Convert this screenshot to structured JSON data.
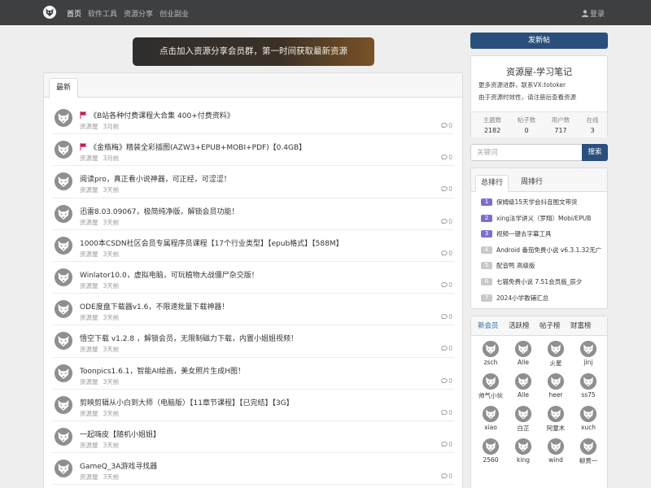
{
  "nav": {
    "logo_icon": "fox-logo-icon",
    "links": [
      "首页",
      "软件工具",
      "资源分享",
      "创业副业"
    ],
    "active_index": 0,
    "login_label": "登录",
    "login_icon": "user-icon"
  },
  "banner": {
    "text": "点击加入资源分享会员群，第一时间获取最新资源"
  },
  "main": {
    "tab_label": "最新",
    "threads": [
      {
        "pinned": true,
        "title": "《B站各种付费课程大合集 400+付费资料》",
        "author": "资源屋",
        "time": "3月前",
        "replies": "0"
      },
      {
        "pinned": true,
        "title": "《金瓶梅》精装全彩插图(AZW3+EPUB+MOBI+PDF)【0.4GB】",
        "author": "资源屋",
        "time": "3月前",
        "replies": "0"
      },
      {
        "pinned": false,
        "title": "阅读pro，真正看小说神器，可正经，可涩涩！",
        "author": "资源屋",
        "time": "3天前",
        "replies": "0"
      },
      {
        "pinned": false,
        "title": "迅雷8.03.09067，极简纯净版，解锁会员功能！",
        "author": "资源屋",
        "time": "3天前",
        "replies": "0"
      },
      {
        "pinned": false,
        "title": "1000本CSDN社区会员专属程序员课程【17个行业类型】【epub格式】【588M】",
        "author": "资源屋",
        "time": "3天前",
        "replies": "0"
      },
      {
        "pinned": false,
        "title": "Winlator10.0，虚拟电脑，可玩植物大战僵尸杂交版！",
        "author": "资源屋",
        "time": "3天前",
        "replies": "0"
      },
      {
        "pinned": false,
        "title": "ODE度盘下载器v1.6，不限速批量下载神器！",
        "author": "资源屋",
        "time": "3天前",
        "replies": "0"
      },
      {
        "pinned": false,
        "title": "悟空下载 v1.2.8 ，解锁会员，无限制磁力下载，内置小姐姐视频！",
        "author": "资源屋",
        "time": "3天前",
        "replies": "0"
      },
      {
        "pinned": false,
        "title": "Toonpics1.6.1，智能AI绘画，美女照片生成H图！",
        "author": "资源屋",
        "time": "3天前",
        "replies": "0"
      },
      {
        "pinned": false,
        "title": "剪映剪辑从小白到大师（电脑版）【11章节课程】【已完结】【3G】",
        "author": "资源屋",
        "time": "3天前",
        "replies": "0"
      },
      {
        "pinned": false,
        "title": "一起嗨皮【随机小姐姐】",
        "author": "资源屋",
        "time": "3天前",
        "replies": "0"
      },
      {
        "pinned": false,
        "title": "GameQ_3A游戏寻找器",
        "author": "资源屋",
        "time": "3天前",
        "replies": "0"
      }
    ]
  },
  "sidebar": {
    "new_post_label": "发新帖",
    "site": {
      "title": "资源屋-学习笔记",
      "desc_line1": "更多资源进群，联系VX:totoker",
      "desc_line2": "由于资源时效性，请注册后查看资源",
      "stats": [
        {
          "label": "主题数",
          "value": "2182"
        },
        {
          "label": "帖子数",
          "value": "0"
        },
        {
          "label": "用户数",
          "value": "717"
        },
        {
          "label": "在线",
          "value": "3"
        }
      ]
    },
    "search": {
      "placeholder": "关键词",
      "button_label": "搜索"
    },
    "ranking": {
      "tabs": [
        "总排行",
        "周排行"
      ],
      "active_index": 0,
      "items": [
        {
          "rank": "1",
          "title": "保姆级15天学会抖音图文带货"
        },
        {
          "rank": "2",
          "title": "xing法学讲义（罗翔）Mobi/EPUB"
        },
        {
          "rank": "3",
          "title": "视频一键去字幕工具"
        },
        {
          "rank": "4",
          "title": "Android 番茄免费小说 v6.3.1.32无广"
        },
        {
          "rank": "5",
          "title": "配音鸭 高级版"
        },
        {
          "rank": "6",
          "title": "七猫免费小说 7.51会员版_辰夕"
        },
        {
          "rank": "7",
          "title": "2024小学教辅汇总"
        }
      ]
    },
    "members": {
      "tabs": [
        "新会员",
        "活跃榜",
        "帖子榜",
        "财富榜"
      ],
      "active_index": 0,
      "list": [
        "zsch",
        "Alle",
        "火星",
        "jinj",
        "帅气小伙",
        "Alle",
        "heer",
        "ss75",
        "xiao",
        "白芷",
        "阿童木",
        "xuch",
        "2560",
        "king",
        "wind",
        "柳贯一"
      ]
    }
  },
  "colors": {
    "navbar_bg": "#3d3f41",
    "primary_button": "#2b4f7d",
    "rank_top": "#7a6fd1",
    "pin_flag": "#c2185b"
  }
}
